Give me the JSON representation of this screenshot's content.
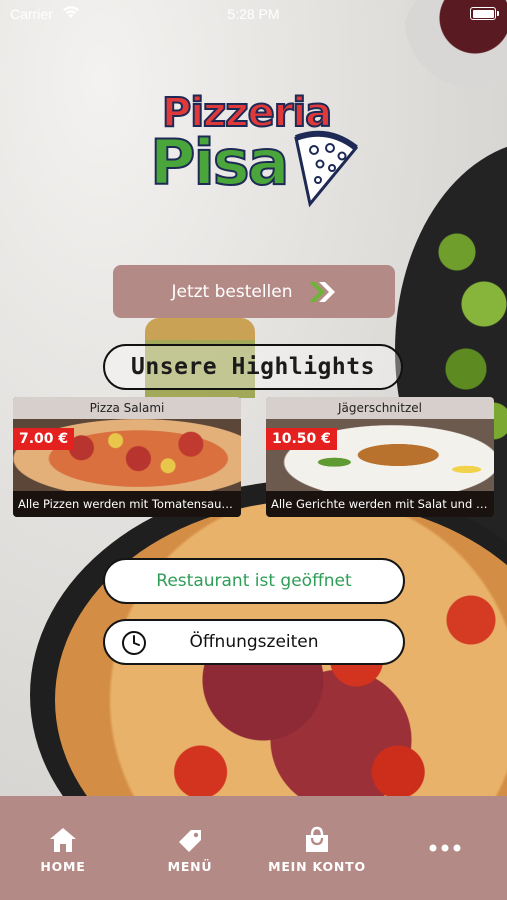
{
  "status_bar": {
    "carrier": "Carrier",
    "time": "5:28 PM",
    "wifi_icon": "wifi-icon",
    "battery_icon": "battery-icon"
  },
  "logo": {
    "line1": "Pizzeria",
    "line2": "Pisa",
    "icon": "pizza-slice-icon"
  },
  "order_button": {
    "label": "Jetzt bestellen",
    "icon": "double-chevron-right-icon"
  },
  "highlights": {
    "title": "Unsere Highlights",
    "items": [
      {
        "name": "Pizza Salami",
        "price": "7.00 €",
        "description": "Alle Pizzen werden mit Tomatensauce, K..."
      },
      {
        "name": "Jägerschnitzel",
        "price": "10.50 €",
        "description": "Alle Gerichte werden mit Salat und eine..."
      }
    ]
  },
  "restaurant_status": {
    "label": "Restaurant ist geöffnet",
    "color": "#2e9e56"
  },
  "opening_hours": {
    "label": "Öffnungszeiten",
    "icon": "clock-icon"
  },
  "tab_bar": {
    "items": [
      {
        "label": "HOME",
        "icon": "home-icon"
      },
      {
        "label": "MENÜ",
        "icon": "tag-icon"
      },
      {
        "label": "MEIN KONTO",
        "icon": "shopping-bag-icon"
      }
    ],
    "more_icon": "more-dots-icon"
  },
  "colors": {
    "accent": "#b48a87",
    "price_badge": "#e4211e",
    "logo_red": "#e0393a",
    "logo_green": "#4aa63a"
  }
}
